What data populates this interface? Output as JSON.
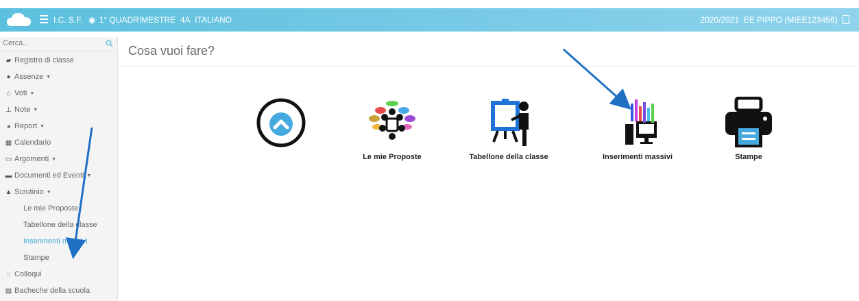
{
  "header": {
    "breadcrumb": "I.C. S.F.",
    "period": "1° QUADRIMESTRE",
    "class": "4A",
    "subject": "ITALIANO",
    "year": "2020/2021",
    "user": "EE PIPPO (MIEE123456)"
  },
  "sidebar": {
    "search_placeholder": "Cerca..",
    "items": [
      {
        "label": "Registro di classe",
        "icon": "book-icon"
      },
      {
        "label": "Assenze",
        "icon": "user-icon",
        "caret": true
      },
      {
        "label": "Voti",
        "icon": "bank-icon",
        "caret": true
      },
      {
        "label": "Note",
        "icon": "pin-icon",
        "caret": true
      },
      {
        "label": "Report",
        "icon": "pie-chart-icon",
        "caret": true
      },
      {
        "label": "Calendario",
        "icon": "calendar-icon"
      },
      {
        "label": "Argomenti",
        "icon": "folder-open-icon",
        "caret": true
      },
      {
        "label": "Documenti ed Eventi",
        "icon": "archive-icon",
        "caret": true
      },
      {
        "label": "Scrutinio",
        "icon": "graduation-cap-icon",
        "caret": true
      },
      {
        "label": "Le mie Proposte",
        "sub": true
      },
      {
        "label": "Tabellone della classe",
        "sub": true
      },
      {
        "label": "Inserimenti massivi",
        "sub": true,
        "active": true
      },
      {
        "label": "Stampe",
        "sub": true
      },
      {
        "label": "Colloqui",
        "icon": "comments-icon"
      },
      {
        "label": "Bacheche della scuola",
        "icon": "board-icon"
      }
    ]
  },
  "main": {
    "title": "Cosa vuoi fare?",
    "tiles": [
      {
        "label": "",
        "icon": "chevron-up-circle-icon"
      },
      {
        "label": "Le mie Proposte",
        "icon": "meeting-icon"
      },
      {
        "label": "Tabellone della classe",
        "icon": "presentation-icon"
      },
      {
        "label": "Inserimenti massivi",
        "icon": "computer-bars-icon"
      },
      {
        "label": "Stampe",
        "icon": "printer-icon"
      }
    ]
  },
  "colors": {
    "header": "#5bc0de",
    "active_link": "#42a8d6",
    "arrow": "#1f6fc4"
  }
}
